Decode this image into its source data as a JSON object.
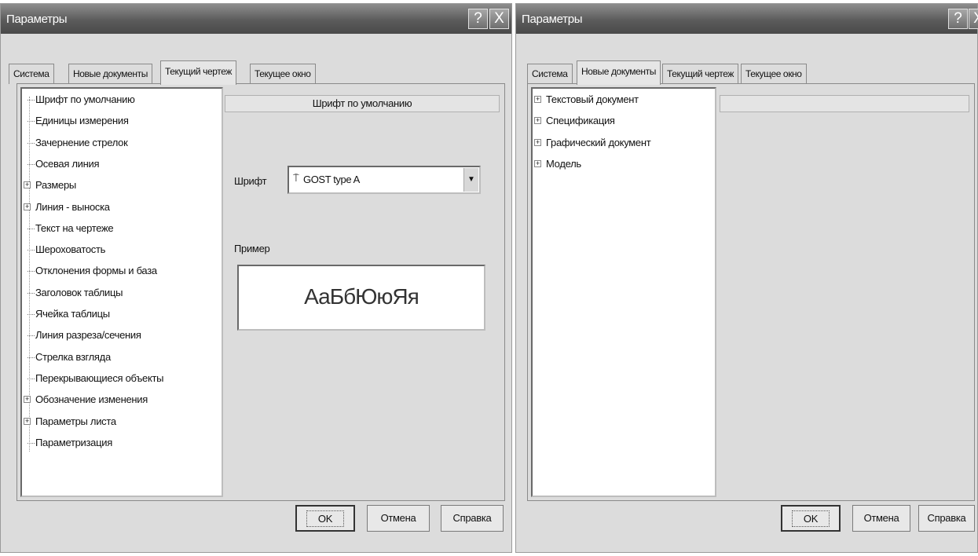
{
  "left_dialog": {
    "title": "Параметры",
    "help_glyph": "?",
    "close_glyph": "X",
    "tabs": [
      "Система",
      "Новые документы",
      "Текущий чертеж",
      "Текущее окно"
    ],
    "active_tab": "Текущий чертеж",
    "tree_items": [
      {
        "label": "Шрифт по умолчанию",
        "expandable": false
      },
      {
        "label": "Единицы измерения",
        "expandable": false
      },
      {
        "label": "Зачернение стрелок",
        "expandable": false
      },
      {
        "label": "Осевая линия",
        "expandable": false
      },
      {
        "label": "Размеры",
        "expandable": true
      },
      {
        "label": "Линия - выноска",
        "expandable": true
      },
      {
        "label": "Текст на чертеже",
        "expandable": false
      },
      {
        "label": "Шероховатость",
        "expandable": false
      },
      {
        "label": "Отклонения формы и база",
        "expandable": false
      },
      {
        "label": "Заголовок таблицы",
        "expandable": false
      },
      {
        "label": "Ячейка таблицы",
        "expandable": false
      },
      {
        "label": "Линия разреза/сечения",
        "expandable": false
      },
      {
        "label": "Стрелка взгляда",
        "expandable": false
      },
      {
        "label": "Перекрывающиеся объекты",
        "expandable": false
      },
      {
        "label": "Обозначение изменения",
        "expandable": true
      },
      {
        "label": "Параметры листа",
        "expandable": true
      },
      {
        "label": "Параметризация",
        "expandable": false
      }
    ],
    "props_header": "Шрифт по умолчанию",
    "font_label": "Шрифт",
    "font_value": "GOST type A",
    "font_icon": "truetype-font-icon",
    "example_label": "Пример",
    "example_text": "АаБбЮюЯя",
    "buttons": {
      "ok": "OK",
      "cancel": "Отмена",
      "help": "Справка"
    }
  },
  "right_dialog": {
    "title": "Параметры",
    "help_glyph": "?",
    "close_glyph": "X",
    "tabs": [
      "Система",
      "Новые документы",
      "Текущий чертеж",
      "Текущее окно"
    ],
    "active_tab": "Новые документы",
    "tree_items": [
      {
        "label": "Текстовый документ",
        "expandable": true
      },
      {
        "label": "Спецификация",
        "expandable": true
      },
      {
        "label": "Графический документ",
        "expandable": true
      },
      {
        "label": "Модель",
        "expandable": true
      }
    ],
    "buttons": {
      "ok": "OK",
      "cancel": "Отмена",
      "help": "Справка"
    }
  }
}
